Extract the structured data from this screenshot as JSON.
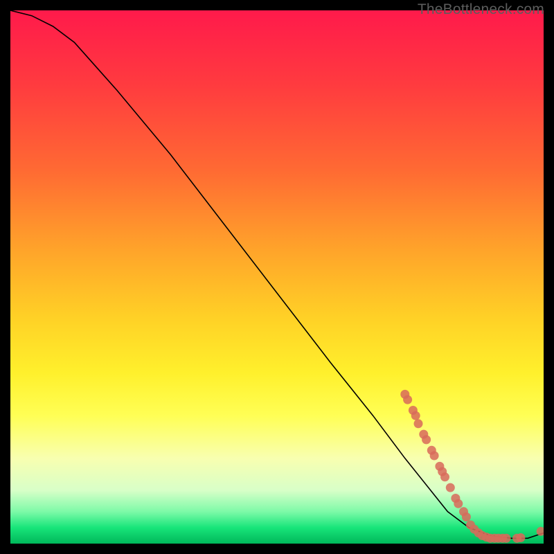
{
  "watermark": "TheBottleneck.com",
  "chart_data": {
    "type": "line",
    "title": "",
    "xlabel": "",
    "ylabel": "",
    "xlim": [
      0,
      100
    ],
    "ylim": [
      0,
      100
    ],
    "series": [
      {
        "name": "curve",
        "x": [
          0,
          4,
          8,
          12,
          20,
          30,
          40,
          50,
          60,
          68,
          74,
          78,
          82,
          86,
          90,
          94,
          97,
          100
        ],
        "y": [
          100,
          99,
          97,
          94,
          85,
          73,
          60,
          47,
          34,
          24,
          16,
          11,
          6,
          3,
          1.5,
          1,
          1,
          2
        ]
      }
    ],
    "markers": [
      {
        "x": 74.0,
        "y": 28.0
      },
      {
        "x": 74.5,
        "y": 27.0
      },
      {
        "x": 75.5,
        "y": 25.0
      },
      {
        "x": 76.0,
        "y": 24.0
      },
      {
        "x": 76.5,
        "y": 22.5
      },
      {
        "x": 77.5,
        "y": 20.5
      },
      {
        "x": 78.0,
        "y": 19.5
      },
      {
        "x": 79.0,
        "y": 17.5
      },
      {
        "x": 79.5,
        "y": 16.5
      },
      {
        "x": 80.5,
        "y": 14.5
      },
      {
        "x": 81.0,
        "y": 13.5
      },
      {
        "x": 81.5,
        "y": 12.5
      },
      {
        "x": 82.5,
        "y": 10.5
      },
      {
        "x": 83.5,
        "y": 8.5
      },
      {
        "x": 84.0,
        "y": 7.5
      },
      {
        "x": 85.0,
        "y": 6.0
      },
      {
        "x": 85.5,
        "y": 5.0
      },
      {
        "x": 86.3,
        "y": 3.5
      },
      {
        "x": 87.0,
        "y": 2.7
      },
      {
        "x": 87.8,
        "y": 2.0
      },
      {
        "x": 88.5,
        "y": 1.5
      },
      {
        "x": 89.3,
        "y": 1.2
      },
      {
        "x": 90.0,
        "y": 1.0
      },
      {
        "x": 90.8,
        "y": 1.0
      },
      {
        "x": 91.5,
        "y": 1.0
      },
      {
        "x": 92.3,
        "y": 1.0
      },
      {
        "x": 93.0,
        "y": 1.0
      },
      {
        "x": 95.0,
        "y": 1.0
      },
      {
        "x": 95.7,
        "y": 1.1
      },
      {
        "x": 99.5,
        "y": 2.3
      }
    ],
    "marker_color": "#d86a5a",
    "line_color": "#000000"
  }
}
